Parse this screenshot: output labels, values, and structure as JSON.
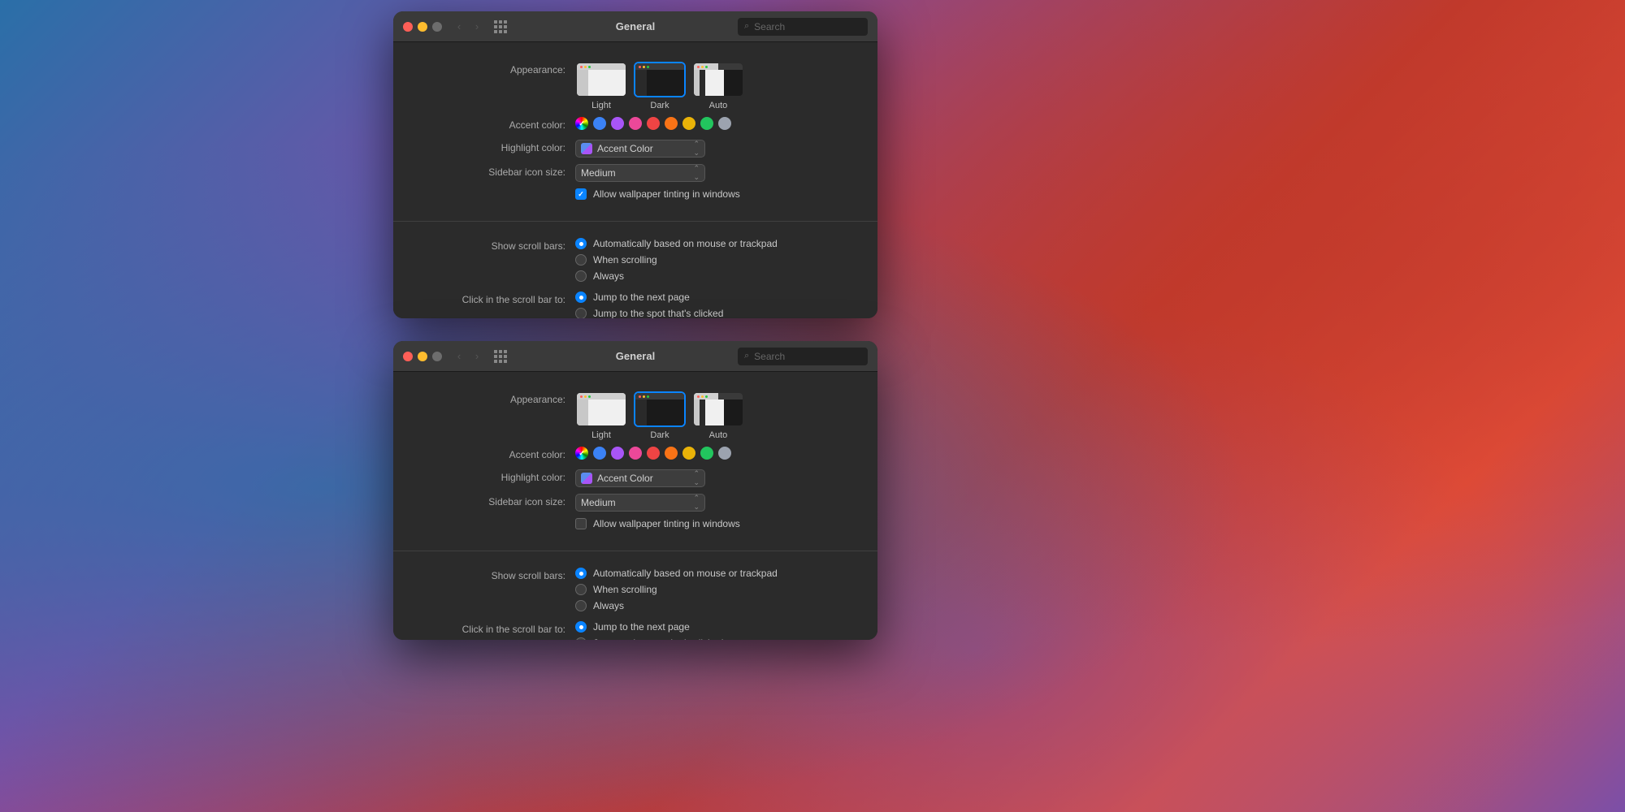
{
  "background": {
    "gradient": "macOS Big Sur wallpaper gradient"
  },
  "windows": [
    {
      "id": "top",
      "title": "General",
      "search_placeholder": "Search",
      "appearance": {
        "label": "Appearance:",
        "options": [
          {
            "id": "light",
            "label": "Light",
            "selected": false
          },
          {
            "id": "dark",
            "label": "Dark",
            "selected": true
          },
          {
            "id": "auto",
            "label": "Auto",
            "selected": false
          }
        ]
      },
      "accent_color": {
        "label": "Accent color:",
        "colors": [
          {
            "name": "multicolor",
            "hex": "multicolor",
            "selected": true
          },
          {
            "name": "blue",
            "hex": "#3b82f6"
          },
          {
            "name": "purple",
            "hex": "#a855f7"
          },
          {
            "name": "pink",
            "hex": "#ec4899"
          },
          {
            "name": "red",
            "hex": "#ef4444"
          },
          {
            "name": "orange",
            "hex": "#f97316"
          },
          {
            "name": "yellow",
            "hex": "#eab308"
          },
          {
            "name": "green",
            "hex": "#22c55e"
          },
          {
            "name": "graphite",
            "hex": "#9ca3af"
          }
        ]
      },
      "highlight_color": {
        "label": "Highlight color:",
        "value": "Accent Color"
      },
      "sidebar_icon_size": {
        "label": "Sidebar icon size:",
        "value": "Medium"
      },
      "wallpaper_tinting": {
        "label": "",
        "text": "Allow wallpaper tinting in windows",
        "checked": true
      },
      "show_scroll_bars": {
        "label": "Show scroll bars:",
        "options": [
          {
            "id": "auto",
            "label": "Automatically based on mouse or trackpad",
            "selected": true
          },
          {
            "id": "scrolling",
            "label": "When scrolling",
            "selected": false
          },
          {
            "id": "always",
            "label": "Always",
            "selected": false
          }
        ]
      },
      "click_scroll_bar": {
        "label": "Click in the scroll bar to:",
        "options": [
          {
            "id": "next_page",
            "label": "Jump to the next page",
            "selected": true
          },
          {
            "id": "spot",
            "label": "Jump to the spot that's clicked",
            "selected": false
          }
        ]
      }
    },
    {
      "id": "bottom",
      "title": "General",
      "search_placeholder": "Search",
      "appearance": {
        "label": "Appearance:",
        "options": [
          {
            "id": "light",
            "label": "Light",
            "selected": false
          },
          {
            "id": "dark",
            "label": "Dark",
            "selected": true
          },
          {
            "id": "auto",
            "label": "Auto",
            "selected": false
          }
        ]
      },
      "accent_color": {
        "label": "Accent color:",
        "colors": [
          {
            "name": "multicolor",
            "hex": "multicolor",
            "selected": true
          },
          {
            "name": "blue",
            "hex": "#3b82f6"
          },
          {
            "name": "purple",
            "hex": "#a855f7"
          },
          {
            "name": "pink",
            "hex": "#ec4899"
          },
          {
            "name": "red",
            "hex": "#ef4444"
          },
          {
            "name": "orange",
            "hex": "#f97316"
          },
          {
            "name": "yellow",
            "hex": "#eab308"
          },
          {
            "name": "green",
            "hex": "#22c55e"
          },
          {
            "name": "graphite",
            "hex": "#9ca3af"
          }
        ]
      },
      "highlight_color": {
        "label": "Highlight color:",
        "value": "Accent Color"
      },
      "sidebar_icon_size": {
        "label": "Sidebar icon size:",
        "value": "Medium"
      },
      "wallpaper_tinting": {
        "label": "",
        "text": "Allow wallpaper tinting in windows",
        "checked": false
      },
      "show_scroll_bars": {
        "label": "Show scroll bars:",
        "options": [
          {
            "id": "auto",
            "label": "Automatically based on mouse or trackpad",
            "selected": true
          },
          {
            "id": "scrolling",
            "label": "When scrolling",
            "selected": false
          },
          {
            "id": "always",
            "label": "Always",
            "selected": false
          }
        ]
      },
      "click_scroll_bar": {
        "label": "Click in the scroll bar to:",
        "options": [
          {
            "id": "next_page",
            "label": "Jump to the next page",
            "selected": true
          },
          {
            "id": "spot",
            "label": "Jump to the spot that's clicked",
            "selected": false
          }
        ]
      }
    }
  ],
  "labels": {
    "appearance": "Appearance:",
    "accent_color": "Accent color:",
    "highlight_color": "Highlight color:",
    "sidebar_icon_size": "Sidebar icon size:",
    "show_scroll_bars": "Show scroll bars:",
    "click_scroll_bar": "Click in the scroll bar to:",
    "light": "Light",
    "dark": "Dark",
    "auto": "Auto",
    "medium": "Medium",
    "accent_color_value": "Accent Color",
    "wallpaper_tinting": "Allow wallpaper tinting in windows",
    "auto_scroll": "Automatically based on mouse or trackpad",
    "when_scrolling": "When scrolling",
    "always": "Always",
    "jump_next_page": "Jump to the next page",
    "jump_spot": "Jump to the spot that's clicked",
    "general": "General",
    "search": "Search"
  }
}
